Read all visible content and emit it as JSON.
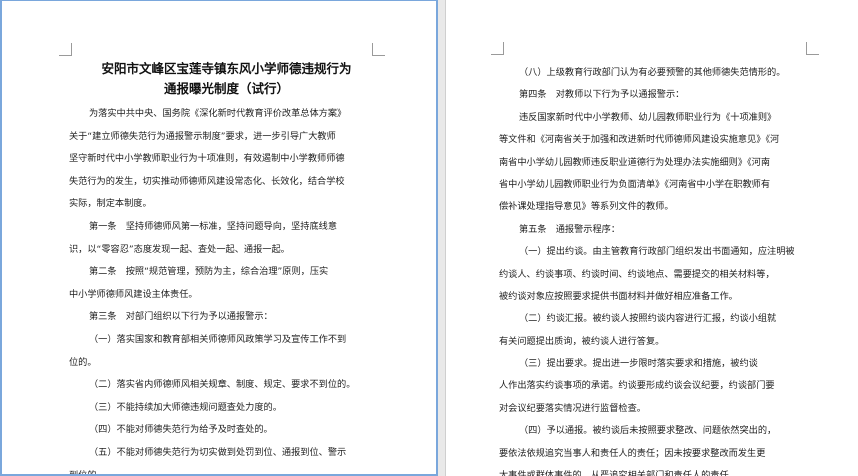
{
  "left_page": {
    "title_lines": [
      "安阳市文峰区宝莲寺镇东风小学师德违规行为",
      "通报曝光制度（试行）"
    ],
    "lines": [
      {
        "text": "为落实中共中央、国务院《深化新时代教育评价改革总体方案》",
        "indent": true
      },
      {
        "text": "关于“建立师德失范行为通报警示制度”要求，进一步引导广大教师",
        "indent": false
      },
      {
        "text": "坚守新时代中小学教师职业行为十项准则，有效遏制中小学教师师德",
        "indent": false
      },
      {
        "text": "失范行为的发生，切实推动师德师风建设常态化、长效化，结合学校",
        "indent": false
      },
      {
        "text": "实际，制定本制度。",
        "indent": false
      },
      {
        "text": "第一条　坚持师德师风第一标准，坚持问题导向，坚持底线意",
        "indent": true
      },
      {
        "text": "识，以“零容忍”态度发现一起、查处一起、通报一起。",
        "indent": false
      },
      {
        "text": "第二条　按照“规范管理，预防为主，综合治理”原则，压实",
        "indent": true
      },
      {
        "text": "中小学师德师风建设主体责任。",
        "indent": false
      },
      {
        "text": "第三条　对部门组织以下行为予以通报警示：",
        "indent": true
      },
      {
        "text": "（一）落实国家和教育部相关师德师风政策学习及宣传工作不到",
        "indent": true
      },
      {
        "text": "位的。",
        "indent": false
      },
      {
        "text": "（二）落实省内师德师风相关规章、制度、规定、要求不到位的。",
        "indent": true
      },
      {
        "text": "（三）不能持续加大师德违规问题查处力度的。",
        "indent": true
      },
      {
        "text": "（四）不能对师德失范行为给予及时查处的。",
        "indent": true
      },
      {
        "text": "（五）不能对师德失范行为切实做到处罚到位、通报到位、警示",
        "indent": true
      },
      {
        "text": "到位的。",
        "indent": false
      }
    ]
  },
  "right_page": {
    "lines": [
      {
        "text": "（八）上级教育行政部门认为有必要预警的其他师德失范情形的。",
        "indent": true
      },
      {
        "text": "第四条　对教师以下行为予以通报警示：",
        "indent": true
      },
      {
        "text": "违反国家新时代中小学教师、幼儿园教师职业行为《十项准则》",
        "indent": true
      },
      {
        "text": "等文件和《河南省关于加强和改进新时代师德师风建设实施意见》《河",
        "indent": false
      },
      {
        "text": "南省中小学幼儿园教师违反职业道德行为处理办法实施细则》《河南",
        "indent": false
      },
      {
        "text": "省中小学幼儿园教师职业行为负面清单》《河南省中小学在职教师有",
        "indent": false
      },
      {
        "text": "偿补课处理指导意见》等系列文件的教师。",
        "indent": false
      },
      {
        "text": "第五条　通报警示程序：",
        "indent": true
      },
      {
        "text": "（一）提出约谈。由主管教育行政部门组织发出书面通知，应注明被",
        "indent": true
      },
      {
        "text": "约谈人、约谈事项、约谈时间、约谈地点、需要提交的相关材料等，",
        "indent": false
      },
      {
        "text": "被约谈对象应按照要求提供书面材料并做好相应准备工作。",
        "indent": false
      },
      {
        "text": "（二）约谈汇报。被约谈人按照约谈内容进行汇报，约谈小组就",
        "indent": true
      },
      {
        "text": "有关问题提出质询，被约谈人进行答复。",
        "indent": false
      },
      {
        "text": "（三）提出要求。提出进一步限时落实要求和措施，被约谈",
        "indent": true
      },
      {
        "text": "人作出落实约谈事项的承诺。约谈要形成约谈会议纪要，约谈部门要",
        "indent": false
      },
      {
        "text": "对会议纪要落实情况进行监督检查。",
        "indent": false
      },
      {
        "text": "（四）予以通报。被约谈后未按照要求整改、问题依然突出的，",
        "indent": true
      },
      {
        "text": "要依法依规追究当事人和责任人的责任；因未按要求整改而发生更",
        "indent": false
      },
      {
        "text": "大事件或群体事件的，从严追究相关部门和责任人的责任。",
        "indent": false
      }
    ]
  }
}
